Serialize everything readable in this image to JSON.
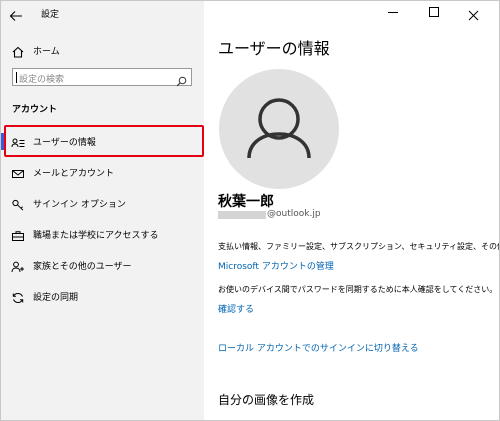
{
  "window": {
    "title": "設定",
    "controls": {
      "minimize": "—",
      "maximize": "☐",
      "close": "✕"
    }
  },
  "sidebar": {
    "home_label": "ホーム",
    "search_placeholder": "設定の検索",
    "section_title": "アカウント",
    "items": [
      {
        "label": "ユーザーの情報",
        "icon": "user-info-icon",
        "selected": true
      },
      {
        "label": "メールとアカウント",
        "icon": "mail-icon"
      },
      {
        "label": "サインイン オプション",
        "icon": "key-icon"
      },
      {
        "label": "職場または学校にアクセスする",
        "icon": "briefcase-icon"
      },
      {
        "label": "家族とその他のユーザー",
        "icon": "person-add-icon"
      },
      {
        "label": "設定の同期",
        "icon": "sync-icon"
      }
    ]
  },
  "main": {
    "page_title": "ユーザーの情報",
    "user_name": "秋葉一郎",
    "email_domain": "@outlook.jp",
    "description": "支払い情報、ファミリー設定、サブスクリプション、セキュリティ設定、その他",
    "manage_link": "Microsoft アカウントの管理",
    "verify_text": "お使いのデバイス間でパスワードを同期するために本人確認をしてください。",
    "verify_link": "確認する",
    "local_link": "ローカル アカウントでのサインインに切り替える",
    "create_picture_heading": "自分の画像を作成"
  },
  "colors": {
    "accent_link": "#0063b1",
    "highlight_box": "#e60012",
    "sidebar_bg": "#f2f2f2"
  }
}
